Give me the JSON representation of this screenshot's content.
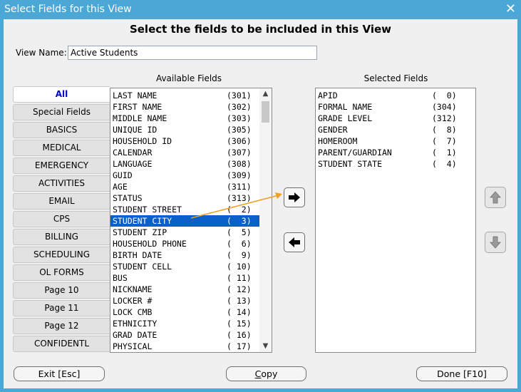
{
  "window": {
    "title": "Select Fields for this View",
    "close_glyph": "✕",
    "heading": "Select the fields to be included in this View"
  },
  "view_name": {
    "label": "View Name:",
    "value": "Active Students"
  },
  "available_label": "Available Fields",
  "selected_label": "Selected Fields",
  "tabs": [
    {
      "label": "All",
      "active": true
    },
    {
      "label": "Special Fields"
    },
    {
      "label": "BASICS"
    },
    {
      "label": "MEDICAL"
    },
    {
      "label": "EMERGENCY"
    },
    {
      "label": "ACTIVITIES"
    },
    {
      "label": "EMAIL"
    },
    {
      "label": "CPS"
    },
    {
      "label": "BILLING"
    },
    {
      "label": "SCHEDULING"
    },
    {
      "label": "OL FORMS"
    },
    {
      "label": "Page 10"
    },
    {
      "label": "Page 11"
    },
    {
      "label": "Page 12"
    },
    {
      "label": "CONFIDENTL"
    }
  ],
  "available_fields": [
    {
      "name": "LAST NAME",
      "num": "(301)"
    },
    {
      "name": "FIRST NAME",
      "num": "(302)"
    },
    {
      "name": "MIDDLE NAME",
      "num": "(303)"
    },
    {
      "name": "UNIQUE ID",
      "num": "(305)"
    },
    {
      "name": "HOUSEHOLD ID",
      "num": "(306)"
    },
    {
      "name": "CALENDAR",
      "num": "(307)"
    },
    {
      "name": "LANGUAGE",
      "num": "(308)"
    },
    {
      "name": "GUID",
      "num": "(309)"
    },
    {
      "name": "AGE",
      "num": "(311)"
    },
    {
      "name": "STATUS",
      "num": "(313)"
    },
    {
      "name": "STUDENT STREET",
      "num": "(  2)"
    },
    {
      "name": "STUDENT CITY",
      "num": "(  3)",
      "selected": true
    },
    {
      "name": "STUDENT ZIP",
      "num": "(  5)"
    },
    {
      "name": "HOUSEHOLD PHONE",
      "num": "(  6)"
    },
    {
      "name": "BIRTH DATE",
      "num": "(  9)"
    },
    {
      "name": "STUDENT CELL",
      "num": "( 10)"
    },
    {
      "name": "BUS",
      "num": "( 11)"
    },
    {
      "name": "NICKNAME",
      "num": "( 12)"
    },
    {
      "name": "LOCKER #",
      "num": "( 13)"
    },
    {
      "name": "LOCK CMB",
      "num": "( 14)"
    },
    {
      "name": "ETHNICITY",
      "num": "( 15)"
    },
    {
      "name": "GRAD DATE",
      "num": "( 16)"
    },
    {
      "name": "PHYSICAL",
      "num": "( 17)"
    }
  ],
  "selected_fields": [
    {
      "name": "APID",
      "num": "(  0)"
    },
    {
      "name": "FORMAL NAME",
      "num": "(304)"
    },
    {
      "name": "GRADE LEVEL",
      "num": "(312)"
    },
    {
      "name": "GENDER",
      "num": "(  8)"
    },
    {
      "name": "HOMEROOM",
      "num": "(  7)"
    },
    {
      "name": "PARENT/GUARDIAN",
      "num": "(  1)"
    },
    {
      "name": "STUDENT STATE",
      "num": "(  4)"
    }
  ],
  "scroll": {
    "up_glyph": "▲",
    "down_glyph": "▼"
  },
  "buttons": {
    "exit": "Exit [Esc]",
    "copy_first": "C",
    "copy_rest": "opy",
    "done": "Done [F10]"
  },
  "colors": {
    "titlebar": "#4aa7d6",
    "selection": "#0a5fc9",
    "annotation_arrow": "#f0a020",
    "active_tab_text": "#0000cc"
  },
  "icons": {
    "add": "arrow-right-icon",
    "remove": "arrow-left-icon",
    "move_up": "arrow-up-icon",
    "move_down": "arrow-down-icon"
  }
}
